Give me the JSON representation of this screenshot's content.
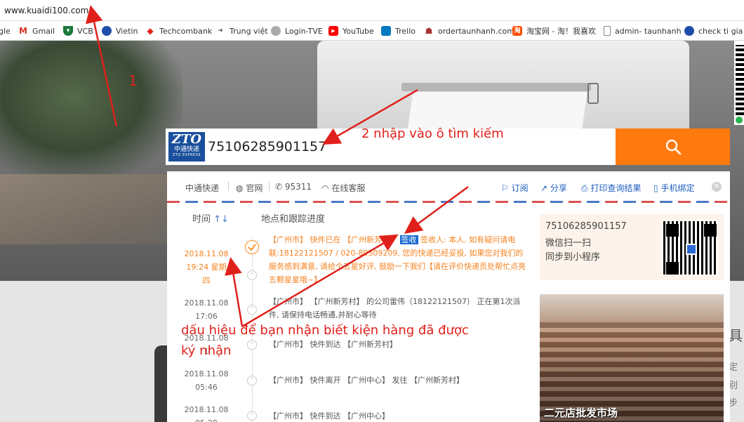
{
  "browser": {
    "url": "www.kuaidi100.com",
    "bookmarks": [
      {
        "label": "gle",
        "icon": "google-icon",
        "color": "#4285f4"
      },
      {
        "label": "Gmail",
        "icon": "gmail-icon",
        "color": "#d93025"
      },
      {
        "label": "VCB",
        "icon": "vcb-icon",
        "color": "#1b7a3c"
      },
      {
        "label": "Vietin",
        "icon": "vietin-icon",
        "color": "#1f4ea8"
      },
      {
        "label": "Techcombank",
        "icon": "techcombank-icon",
        "color": "#e2231a"
      },
      {
        "label": "Trung việt",
        "icon": "arrow-icon",
        "color": "#555555"
      },
      {
        "label": "Login-TVE",
        "icon": "login-icon",
        "color": "#777777"
      },
      {
        "label": "YouTube",
        "icon": "youtube-icon",
        "color": "#ff0000"
      },
      {
        "label": "Trello",
        "icon": "trello-icon",
        "color": "#0079bf"
      },
      {
        "label": "ordertaunhanh.com",
        "icon": "order-icon",
        "color": "#a33"
      },
      {
        "label": "淘宝网 - 淘！我喜欢",
        "icon": "taobao-icon",
        "color": "#ff5000"
      },
      {
        "label": "admin- taunhanh",
        "icon": "page-icon",
        "color": "#888888"
      },
      {
        "label": "check ti gia",
        "icon": "check-icon",
        "color": "#1f4ea8"
      }
    ]
  },
  "search": {
    "logo_main": "ZTO",
    "logo_cn": "中通快递",
    "logo_en": "ZTO EXPRESS",
    "value": "75106285901157",
    "button_icon": "search-icon",
    "accent": "#ff7a0e"
  },
  "toolbar": {
    "carrier": "中通快递",
    "website": "官网",
    "phone": "95311",
    "service": "在线客服",
    "subscribe": "订阅",
    "share": "分享",
    "print": "打印查询结果",
    "bind_phone": "手机绑定"
  },
  "tracking": {
    "col_time": "时间",
    "col_detail": "地点和跟踪进度",
    "events": [
      {
        "date": "2018.11.08",
        "time": "19:24 星期四",
        "highlight": true,
        "text_before": "【广州市】 快件已在 【广州新芳村】 ",
        "status": "签收",
        "text_after": " 签收人: 本人, 如有疑问请电联:18122121507 / 020-80509209, 您的快递已经妥投, 如果您对我们的服务感到满意, 请给个五星好评, 鼓励一下我们【请在评价快递员处帮忙点亮五颗星星哦~】"
      },
      {
        "date": "2018.11.08",
        "time": "17:06",
        "highlight": false,
        "text": "【广州市】 【广州新芳村】 的公司雷伟（18122121507） 正在第1次派件, 请保持电话畅通,并耐心等待"
      },
      {
        "date": "2018.11.08",
        "time": "1",
        "highlight": false,
        "text": "【广州市】 快件到达 【广州新芳村】"
      },
      {
        "date": "2018.11.08",
        "time": "05:46",
        "highlight": false,
        "text": "【广州市】 快件离开 【广州中心】 发往 【广州新芳村】"
      },
      {
        "date": "2018.11.08",
        "time": "05:20",
        "highlight": false,
        "text": "【广州市】 快件到达 【广州中心】"
      }
    ]
  },
  "side": {
    "tracking_no": "75106285901157",
    "line2": "微信扫一扫",
    "line3": "同步到小程序",
    "ad_caption": "二元店批发市场"
  },
  "right_edge": {
    "t1": "具",
    "t2": "定",
    "t3": "别",
    "t4": "步"
  },
  "annotations": {
    "a1": "1",
    "a2": "2 nhập vào ô tìm kiếm",
    "a3_line1": "dấu hiệu để bạn nhận biết kiện hàng đã được",
    "a3_line2": "ký nhận",
    "color": "#e0201b"
  }
}
